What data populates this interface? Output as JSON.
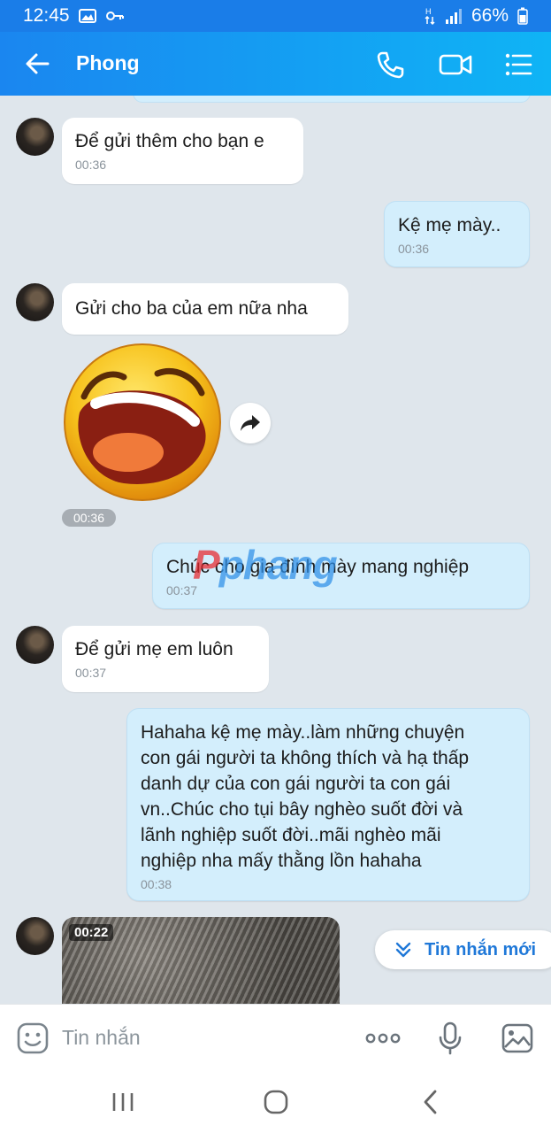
{
  "status_bar": {
    "time": "12:45",
    "battery": "66%"
  },
  "header": {
    "contact_name": "Phong"
  },
  "messages": [
    {
      "dir": "in",
      "text": "Để gửi thêm cho bạn e",
      "time": "00:36"
    },
    {
      "dir": "out",
      "text": "Kệ mẹ mày..",
      "time": "00:36"
    },
    {
      "dir": "in",
      "text": "Gửi cho ba của em nữa nha",
      "time": ""
    },
    {
      "dir": "in",
      "type": "sticker",
      "time": "00:36"
    },
    {
      "dir": "out",
      "text": "Chúc cho gia đình mày mang nghiệp",
      "time": "00:37"
    },
    {
      "dir": "in",
      "text": "Để gửi mẹ em luôn",
      "time": "00:37"
    },
    {
      "dir": "out",
      "text": "Hahaha kệ mẹ mày..làm những chuyện\ncon gái người ta không thích và hạ thấp\ndanh dự của con gái người ta con gái\nvn..Chúc cho tụi bây nghèo suốt đời và\nlãnh nghiệp suốt đời..mãi nghèo mãi\nnghiệp nha mấy thằng lồn hahaha",
      "time": "00:38"
    },
    {
      "dir": "in",
      "type": "video",
      "duration": "00:22"
    }
  ],
  "watermark": {
    "part1": "P",
    "part2": "phang"
  },
  "new_message_button": {
    "label": "Tin nhắn mới"
  },
  "input": {
    "placeholder": "Tin nhắn"
  },
  "colors": {
    "header_start": "#1a86f0",
    "header_end": "#0fb4f5",
    "outgoing_bubble": "#d3eefc",
    "incoming_bubble": "#ffffff",
    "chat_bg": "#dfe6ec"
  }
}
